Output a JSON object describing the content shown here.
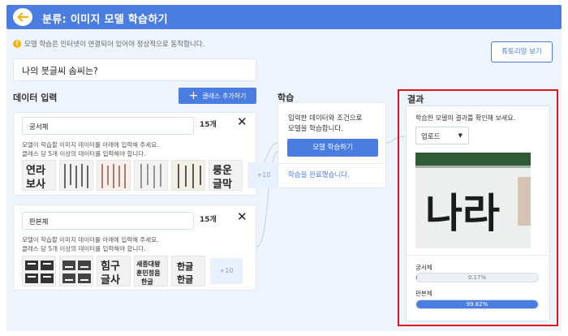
{
  "header": {
    "title": "분류: 이미지 모델 학습하기"
  },
  "notice": {
    "text": "모델 학습은 인터넷이 연결되어 있어야 정상적으로 동작합니다."
  },
  "tutorial_button": "튜토리얼 보기",
  "project_title": "나의 붓글씨 솜씨는?",
  "sections": {
    "data_input": "데이터 입력",
    "learning": "학습",
    "result": "결과"
  },
  "add_class_button": "클래스 추가하기",
  "classes": [
    {
      "name": "궁서체",
      "count": "15개",
      "desc_line1": "모델이 학습할 이미지 데이터를 아래에 입력해 주세요.",
      "desc_line2": "클래스 당 5개 이상의 데이터를 입력해야 합니다.",
      "more": "+10"
    },
    {
      "name": "판본체",
      "count": "15개",
      "desc_line1": "모델이 학습할 이미지 데이터를 아래에 입력해 주세요.",
      "desc_line2": "클래스 당 5개 이상의 데이터를 입력해야 합니다.",
      "more": "+10"
    }
  ],
  "learning": {
    "desc_line1": "입력한 데이터와 조건으로",
    "desc_line2": "모델을 학습합니다.",
    "button": "모델 학습하기",
    "status": "학습을 완료했습니다."
  },
  "result": {
    "desc": "학습한 모델의 결과를 확인해 보세요.",
    "select_value": "업로드",
    "preview_text": "나라",
    "predictions": [
      {
        "name": "궁서체",
        "percent_label": "0.17%",
        "fraction": 0.0017
      },
      {
        "name": "판본체",
        "percent_label": "99.82%",
        "fraction": 0.9982
      }
    ]
  },
  "thumb_glyphs": {
    "c1": [
      "연라",
      "보사",
      "...",
      "...",
      "...",
      "룽운",
      "글막"
    ],
    "c2": [
      "...",
      "...",
      "힘구",
      "새종대왕",
      "훈민정음",
      "한글",
      "한글"
    ]
  },
  "colors": {
    "accent": "#4a7ddf",
    "highlight_border": "#e0141c",
    "warning": "#f2b40d"
  },
  "icons": {
    "back": "arrow-left-icon",
    "add": "plus-icon",
    "remove": "close-icon",
    "warning": "warning-icon",
    "dropdown": "caret-down-icon"
  }
}
